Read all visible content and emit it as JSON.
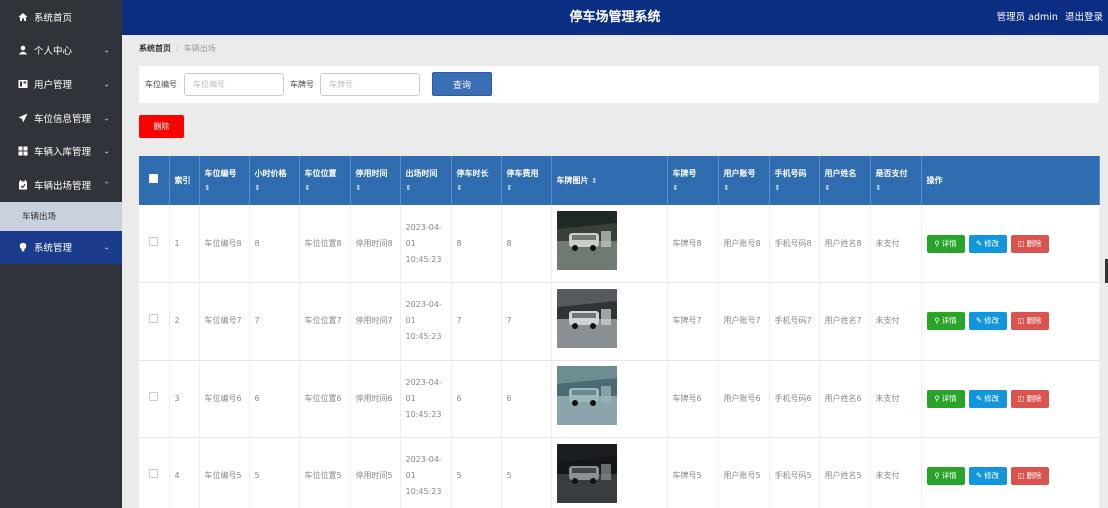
{
  "header": {
    "title": "停车场管理系统",
    "user_label": "管理员 admin",
    "logout": "退出登录"
  },
  "sidebar": {
    "items": [
      {
        "label": "系统首页",
        "icon": "home-icon",
        "chevron": ""
      },
      {
        "label": "个人中心",
        "icon": "user-icon",
        "chevron": "⌄"
      },
      {
        "label": "用户管理",
        "icon": "users-icon",
        "chevron": "⌄"
      },
      {
        "label": "车位信息管理",
        "icon": "send-icon",
        "chevron": "⌄"
      },
      {
        "label": "车辆入库管理",
        "icon": "grid-icon",
        "chevron": "⌄"
      },
      {
        "label": "车辆出场管理",
        "icon": "calendar-icon",
        "chevron": "⌃"
      }
    ],
    "sub_item": "车辆出场",
    "active_item": {
      "label": "系统管理",
      "icon": "bulb-icon",
      "chevron": "⌄"
    }
  },
  "breadcrumb": {
    "home": "系统首页",
    "current": "车辆出场"
  },
  "search": {
    "spot_label": "车位编号",
    "spot_placeholder": "车位编号",
    "plate_label": "车牌号",
    "plate_placeholder": "车牌号",
    "button": "查询"
  },
  "delete_button": "删除",
  "table": {
    "columns": [
      "索引",
      "车位编号",
      "小时价格",
      "车位位置",
      "停用时间",
      "出场时间",
      "停车时长",
      "停车费用",
      "车牌图片",
      "车牌号",
      "用户账号",
      "手机号码",
      "用户姓名",
      "是否支付",
      "操作"
    ],
    "sort_icon": "⇕",
    "actions": {
      "detail": "详情",
      "edit": "修改",
      "remove": "删除"
    },
    "rows": [
      {
        "index": "1",
        "spot": "车位编号8",
        "price": "8",
        "location": "车位位置8",
        "stop_time": "停用时间8",
        "exit_time": "2023-04-01 10:45:23",
        "duration": "8",
        "fee": "8",
        "plate": "车牌号8",
        "account": "用户账号8",
        "phone": "手机号码8",
        "name": "用户姓名8",
        "paid": "未支付"
      },
      {
        "index": "2",
        "spot": "车位编号7",
        "price": "7",
        "location": "车位位置7",
        "stop_time": "停用时间7",
        "exit_time": "2023-04-01 10:45:23",
        "duration": "7",
        "fee": "7",
        "plate": "车牌号7",
        "account": "用户账号7",
        "phone": "手机号码7",
        "name": "用户姓名7",
        "paid": "未支付"
      },
      {
        "index": "3",
        "spot": "车位编号6",
        "price": "6",
        "location": "车位位置6",
        "stop_time": "停用时间6",
        "exit_time": "2023-04-01 10:45:23",
        "duration": "6",
        "fee": "6",
        "plate": "车牌号6",
        "account": "用户账号6",
        "phone": "手机号码6",
        "name": "用户姓名6",
        "paid": "未支付"
      },
      {
        "index": "4",
        "spot": "车位编号5",
        "price": "5",
        "location": "车位位置5",
        "stop_time": "停用时间5",
        "exit_time": "2023-04-01 10:45:23",
        "duration": "5",
        "fee": "5",
        "plate": "车牌号5",
        "account": "用户账号5",
        "phone": "手机号码5",
        "name": "用户姓名5",
        "paid": "未支付"
      }
    ]
  },
  "colors": {
    "sidebar": "#30343a",
    "header": "#0b2e83",
    "table_head": "#2f6db0",
    "detail": "#29a329",
    "edit": "#1296db",
    "remove": "#d9534f",
    "danger": "#ff0000"
  }
}
